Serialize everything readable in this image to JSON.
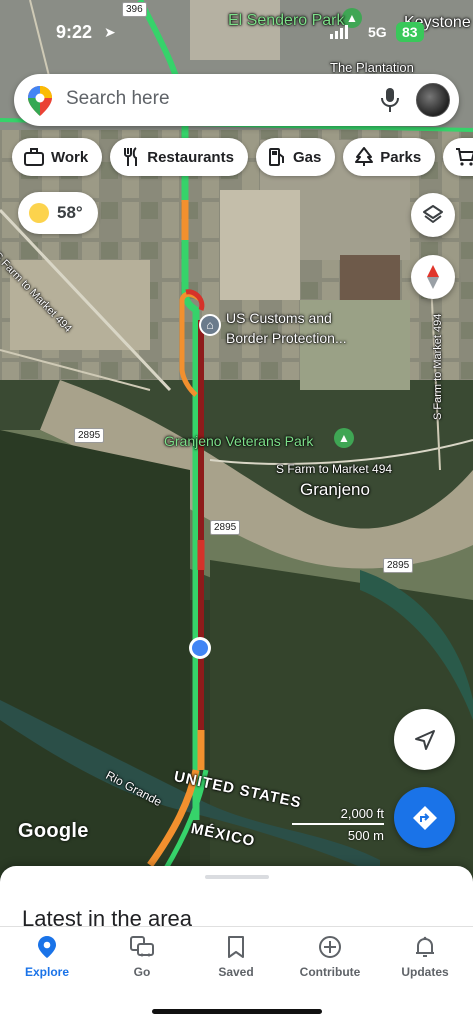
{
  "status_bar": {
    "time": "9:22",
    "network": "5G",
    "battery": "83"
  },
  "search": {
    "placeholder": "Search here"
  },
  "chips": [
    {
      "label": "Work",
      "icon": "briefcase-icon"
    },
    {
      "label": "Restaurants",
      "icon": "fork-knife-icon"
    },
    {
      "label": "Gas",
      "icon": "gas-pump-icon"
    },
    {
      "label": "Parks",
      "icon": "tree-icon"
    }
  ],
  "weather": {
    "temperature": "58°"
  },
  "map": {
    "labels": {
      "el_sendero_park": "El Sendero Park",
      "keystone": "Keystone",
      "the_plantation": "The Plantation",
      "us_customs_line1": "US Customs and",
      "us_customs_line2": "Border Protection...",
      "granjeno_veterans_park": "Granjeno Veterans Park",
      "s_farm_market_494": "S Farm to Market 494",
      "s_farm_market_494_b": "S Farm to Market 494",
      "s_farm_market_494_c": "S Farm to Market 494",
      "granjeno": "Granjeno",
      "rio_grande": "Rio Grande",
      "united_states": "UNITED STATES",
      "mexico": "MÉXICO"
    },
    "shields": {
      "r396": "396",
      "r2895_a": "2895",
      "r2895_b": "2895",
      "r2895_c": "2895"
    },
    "colors": {
      "traffic_green": "#36d36a",
      "traffic_orange": "#f2902e",
      "traffic_red": "#d6322a",
      "traffic_dark_red": "#8e1b1b",
      "location_blue": "#4285f4"
    }
  },
  "branding": {
    "logo": "Google"
  },
  "scale": {
    "feet": "2,000 ft",
    "meters": "500 m"
  },
  "sheet": {
    "title": "Latest in the area"
  },
  "bottom_nav": [
    {
      "label": "Explore",
      "icon": "pin-icon",
      "active": true
    },
    {
      "label": "Go",
      "icon": "commute-icon",
      "active": false
    },
    {
      "label": "Saved",
      "icon": "bookmark-icon",
      "active": false
    },
    {
      "label": "Contribute",
      "icon": "plus-circle-icon",
      "active": false
    },
    {
      "label": "Updates",
      "icon": "bell-icon",
      "active": false
    }
  ]
}
